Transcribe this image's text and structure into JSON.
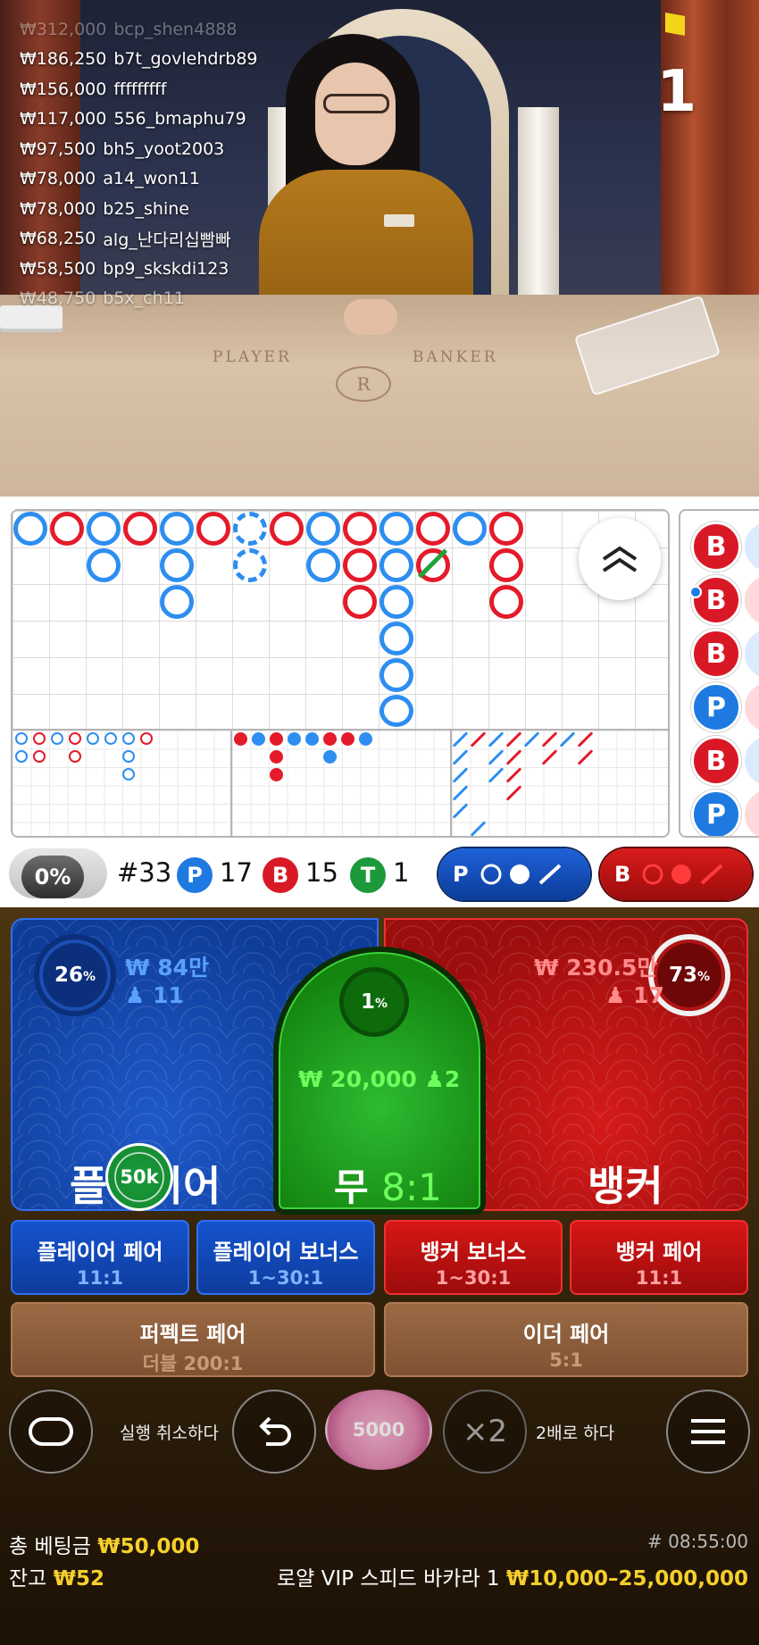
{
  "video": {
    "round_number": "1",
    "felt_player": "PLAYER",
    "felt_banker": "BANKER",
    "felt_logo": "R"
  },
  "winners": [
    {
      "amount": "₩312,000",
      "name": "bcp_shen4888"
    },
    {
      "amount": "₩186,250",
      "name": "b7t_govlehdrb89"
    },
    {
      "amount": "₩156,000",
      "name": "fffffffff"
    },
    {
      "amount": "₩117,000",
      "name": "556_bmaphu79"
    },
    {
      "amount": "₩97,500",
      "name": "bh5_yoot2003"
    },
    {
      "amount": "₩78,000",
      "name": "a14_won11"
    },
    {
      "amount": "₩78,000",
      "name": "b25_shine"
    },
    {
      "amount": "₩68,250",
      "name": "alg_난다리십빰빠"
    },
    {
      "amount": "₩58,500",
      "name": "bp9_skskdi123"
    },
    {
      "amount": "₩48,750",
      "name": "b5x_ch11"
    }
  ],
  "bead_road": [
    "B",
    "B",
    "B",
    "P",
    "B",
    "P"
  ],
  "stats": {
    "percent_toggle": "0%",
    "round_label": "#33",
    "player_badge": "P",
    "player_count": "17",
    "banker_badge": "B",
    "banker_count": "15",
    "tie_badge": "T",
    "tie_count": "1",
    "player_ask": "P",
    "banker_ask": "B"
  },
  "player_panel": {
    "percent": "26",
    "percent_sign": "%",
    "amount": "₩ 84만",
    "bettors": "11",
    "title": "플레이어",
    "chip": "50k"
  },
  "banker_panel": {
    "percent": "73",
    "percent_sign": "%",
    "amount": "₩ 230.5만",
    "bettors": "17",
    "title": "뱅커"
  },
  "tie_panel": {
    "percent": "1",
    "percent_sign": "%",
    "amount": "₩ 20,000",
    "bettors": "2",
    "title": "무",
    "odds": "8:1"
  },
  "side_bets": [
    {
      "label": "플레이어 페어",
      "odds": "11:1"
    },
    {
      "label": "플레이어 보너스",
      "odds": "1~30:1"
    },
    {
      "label": "뱅커 보너스",
      "odds": "1~30:1"
    },
    {
      "label": "뱅커 페어",
      "odds": "11:1"
    },
    {
      "label": "퍼펙트 페어",
      "odds": "더블 200:1"
    },
    {
      "label": "이더 페어",
      "odds": "5:1"
    }
  ],
  "controls": {
    "undo_label": "실행 취소하다",
    "chip_value": "5000",
    "double_icon_text": "×2",
    "double_label": "2배로 하다"
  },
  "footer": {
    "total_bet_label": "총 베팅금",
    "total_bet_value": "₩50,000",
    "balance_label": "잔고",
    "balance_value": "₩52",
    "game_id": "# 08:55:00",
    "table_name": "로얄 VIP 스피드 바카라 1",
    "limits": "₩10,000–25,000,000"
  },
  "colors": {
    "player": "#1e59c9",
    "banker": "#d51a1a",
    "tie": "#2dbb32",
    "gold": "#f5cf2c"
  }
}
